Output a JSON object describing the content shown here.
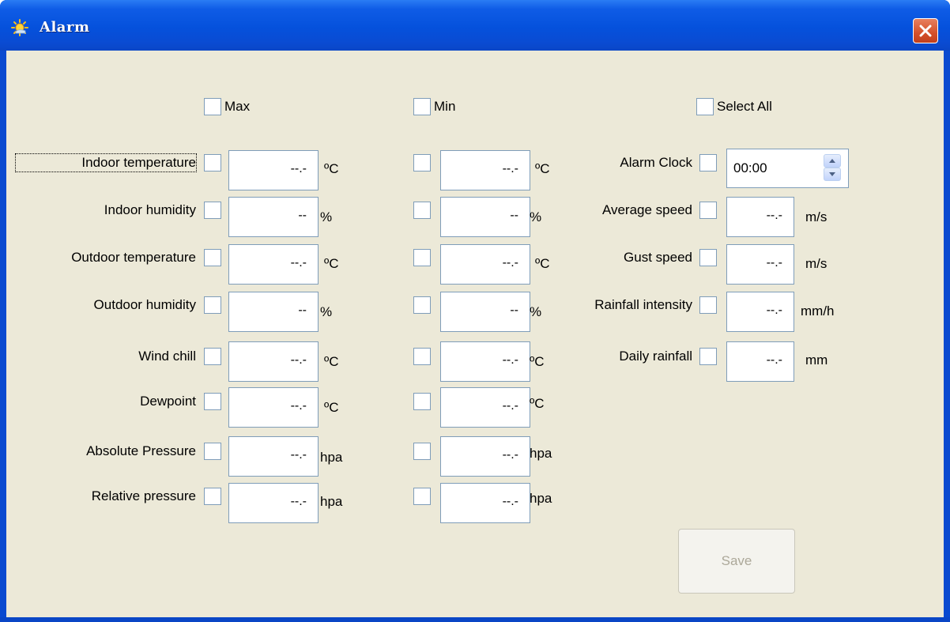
{
  "window": {
    "title": "Alarm",
    "icon": "sun-icon"
  },
  "headers": {
    "max": "Max",
    "min": "Min",
    "select_all": "Select All"
  },
  "rows": [
    {
      "label": "Indoor temperature",
      "max_value": "--.-",
      "min_value": "--.-",
      "unit": "ºC"
    },
    {
      "label": "Indoor humidity",
      "max_value": "--",
      "min_value": "--",
      "unit": "%"
    },
    {
      "label": "Outdoor temperature",
      "max_value": "--.-",
      "min_value": "--.-",
      "unit": "ºC"
    },
    {
      "label": "Outdoor humidity",
      "max_value": "--",
      "min_value": "--",
      "unit": "%"
    },
    {
      "label": "Wind chill",
      "max_value": "--.-",
      "min_value": "--.-",
      "unit": "ºC"
    },
    {
      "label": "Dewpoint",
      "max_value": "--.-",
      "min_value": "--.-",
      "unit": "ºC"
    },
    {
      "label": "Absolute Pressure",
      "max_value": "--.-",
      "min_value": "--.-",
      "unit": "hpa"
    },
    {
      "label": "Relative pressure",
      "max_value": "--.-",
      "min_value": "--.-",
      "unit": "hpa"
    }
  ],
  "alarm_clock": {
    "label": "Alarm Clock",
    "value": "00:00"
  },
  "right_rows": [
    {
      "label": "Average speed",
      "value": "--.-",
      "unit": "m/s"
    },
    {
      "label": "Gust speed",
      "value": "--.-",
      "unit": "m/s"
    },
    {
      "label": "Rainfall intensity",
      "value": "--.-",
      "unit": "mm/h"
    },
    {
      "label": "Daily rainfall",
      "value": "--.-",
      "unit": "mm"
    }
  ],
  "save_button": {
    "label": "Save",
    "enabled": false
  },
  "colors": {
    "titlebar": "#0551dc",
    "client_background": "#ece9d8",
    "close_button": "#d4502a",
    "field_border": "#7f9db9",
    "disabled_text": "#aca899"
  }
}
